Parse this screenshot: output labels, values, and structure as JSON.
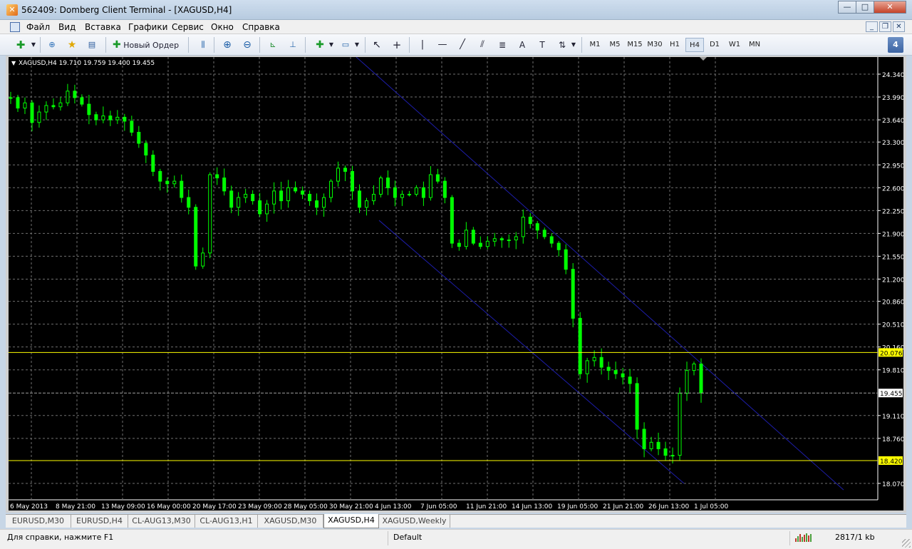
{
  "window": {
    "title": "562409: Domberg Client Terminal - [XAGUSD,H4]",
    "app_icon": "x-logo-icon"
  },
  "menu": {
    "items": [
      "Файл",
      "Вид",
      "Вставка",
      "Графики",
      "Сервис",
      "Окно",
      "Справка"
    ]
  },
  "toolbar": {
    "new_order_label": "Новый Ордер",
    "timeframes": [
      "M1",
      "M5",
      "M15",
      "M30",
      "H1",
      "H4",
      "D1",
      "W1",
      "MN"
    ],
    "active_timeframe": "H4",
    "badge": "4"
  },
  "chart": {
    "symbol_info": "XAGUSD,H4  19.710 19.759 19.400 19.455",
    "price_labels": [
      "24.340",
      "23.990",
      "23.640",
      "23.300",
      "22.950",
      "22.600",
      "22.250",
      "21.900",
      "21.550",
      "21.200",
      "20.860",
      "20.510",
      "20.160",
      "19.810",
      "19.110",
      "18.760",
      "18.070"
    ],
    "price_ticks": [
      24.34,
      23.99,
      23.64,
      23.3,
      22.95,
      22.6,
      22.25,
      21.9,
      21.55,
      21.2,
      20.86,
      20.51,
      20.16,
      19.81,
      19.11,
      18.76,
      18.07
    ],
    "time_labels": [
      "6 May 2013",
      "8 May 21:00",
      "13 May 09:00",
      "16 May 00:00",
      "20 May 17:00",
      "23 May 09:00",
      "28 May 05:00",
      "30 May 21:00",
      "4 Jun 13:00",
      "7 Jun 05:00",
      "11 Jun 21:00",
      "14 Jun 13:00",
      "19 Jun 05:00",
      "21 Jun 21:00",
      "26 Jun 13:00",
      "1 Jul 05:00"
    ],
    "levels": [
      {
        "price": 20.076,
        "label": "20.076",
        "color": "#ffff00"
      },
      {
        "price": 18.42,
        "label": "18.420",
        "color": "#ffff00"
      }
    ],
    "current": {
      "price": 19.455,
      "label": "19.455",
      "color": "#ffffff"
    },
    "colors": {
      "background": "#000000",
      "candles": "#00ff00",
      "grid": "#6f6f6f",
      "channel": "#1d1da8"
    },
    "channel": {
      "upper": {
        "start_price": 24.52,
        "end_price": 17.97
      },
      "lower": {
        "start_price": 22.1,
        "end_price": 18.07
      }
    },
    "closes": [
      23.98,
      23.82,
      23.9,
      23.6,
      23.76,
      23.86,
      23.84,
      23.9,
      24.08,
      23.98,
      23.88,
      23.72,
      23.64,
      23.7,
      23.64,
      23.68,
      23.62,
      23.45,
      23.28,
      23.1,
      22.85,
      22.7,
      22.66,
      22.7,
      22.45,
      22.3,
      21.4,
      21.6,
      22.8,
      22.75,
      22.55,
      22.3,
      22.45,
      22.5,
      22.4,
      22.2,
      22.35,
      22.55,
      22.4,
      22.6,
      22.55,
      22.5,
      22.4,
      22.3,
      22.45,
      22.7,
      22.9,
      22.85,
      22.55,
      22.3,
      22.4,
      22.5,
      22.75,
      22.6,
      22.45,
      22.5,
      22.5,
      22.6,
      22.45,
      22.8,
      22.7,
      22.45,
      21.75,
      21.7,
      21.95,
      21.75,
      21.7,
      21.78,
      21.82,
      21.8,
      21.8,
      21.85,
      22.15,
      22.05,
      21.95,
      21.85,
      21.75,
      21.65,
      21.35,
      20.6,
      19.75,
      19.95,
      20.0,
      19.85,
      19.8,
      19.75,
      19.7,
      19.6,
      18.9,
      18.6,
      18.7,
      18.6,
      18.5,
      18.5,
      19.45,
      19.8,
      19.9,
      19.455
    ]
  },
  "tabs": {
    "items": [
      "EURUSD,M30",
      "EURUSD,H4",
      "CL-AUG13,M30",
      "CL-AUG13,H1",
      "XAGUSD,M30",
      "XAGUSD,H4",
      "XAGUSD,Weekly"
    ],
    "active": "XAGUSD,H4"
  },
  "status": {
    "help": "Для справки, нажмите F1",
    "profile": "Default",
    "traffic": "2817/1 kb"
  }
}
